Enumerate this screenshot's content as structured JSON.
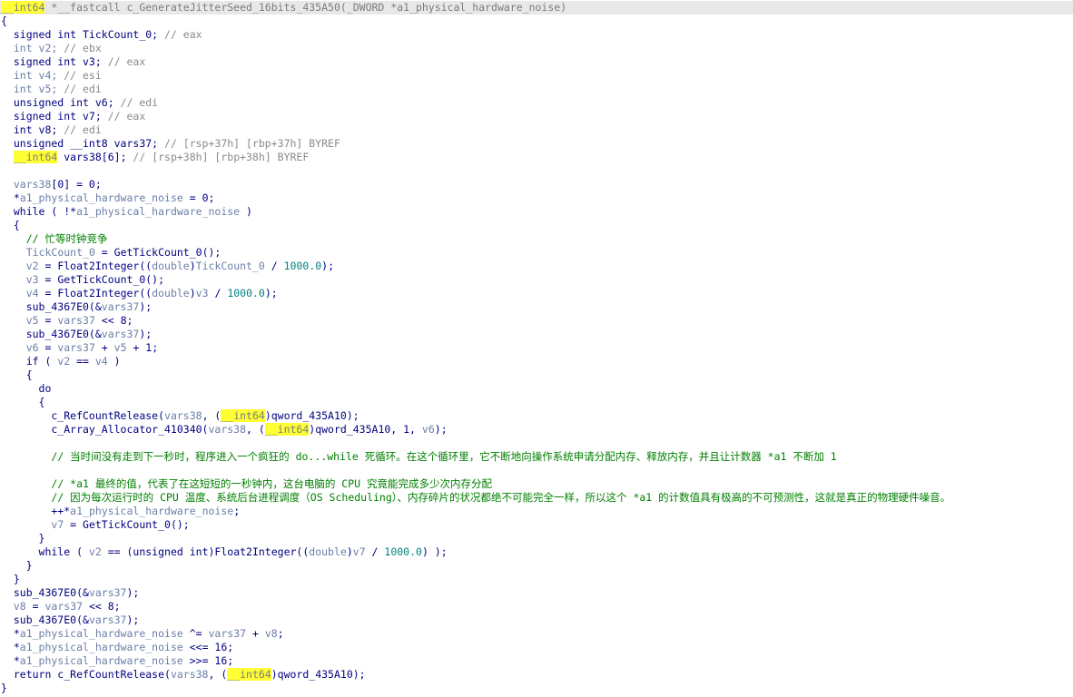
{
  "lines": [
    [
      [
        "hl",
        "__int64"
      ],
      [
        "dim",
        " *__fastcall c_GenerateJitterSeed_16bits_435A50(_DWORD *a1_physical_hardware_noise)"
      ]
    ],
    [
      [
        "code",
        "{"
      ]
    ],
    [
      [
        "code",
        "  signed int TickCount_0; "
      ],
      [
        "comment",
        "// eax"
      ]
    ],
    [
      [
        "var",
        "  int v2; "
      ],
      [
        "comment",
        "// ebx"
      ]
    ],
    [
      [
        "code",
        "  signed int v3; "
      ],
      [
        "comment",
        "// eax"
      ]
    ],
    [
      [
        "var",
        "  int v4; "
      ],
      [
        "comment",
        "// esi"
      ]
    ],
    [
      [
        "var",
        "  int v5; "
      ],
      [
        "comment",
        "// edi"
      ]
    ],
    [
      [
        "code",
        "  unsigned int v6; "
      ],
      [
        "comment",
        "// edi"
      ]
    ],
    [
      [
        "code",
        "  signed int v7; "
      ],
      [
        "comment",
        "// eax"
      ]
    ],
    [
      [
        "code",
        "  int v8; "
      ],
      [
        "comment",
        "// edi"
      ]
    ],
    [
      [
        "code",
        "  unsigned __int8 vars37; "
      ],
      [
        "comment",
        "// [rsp+37h] [rbp+37h] BYREF"
      ]
    ],
    [
      [
        "code",
        "  "
      ],
      [
        "hl",
        "__int64"
      ],
      [
        "code",
        " vars38[6]; "
      ],
      [
        "comment",
        "// [rsp+38h] [rbp+38h] BYREF"
      ]
    ],
    [
      [
        "code",
        ""
      ]
    ],
    [
      [
        "var",
        "  vars38"
      ],
      [
        "code",
        "[0] = 0;"
      ]
    ],
    [
      [
        "code",
        "  *"
      ],
      [
        "var",
        "a1_physical_hardware_noise"
      ],
      [
        "code",
        " = 0;"
      ]
    ],
    [
      [
        "code",
        "  while ( !*"
      ],
      [
        "var",
        "a1_physical_hardware_noise"
      ],
      [
        "code",
        " )"
      ]
    ],
    [
      [
        "code",
        "  {"
      ]
    ],
    [
      [
        "code",
        "    "
      ],
      [
        "commentg",
        "// 忙等时钟竞争"
      ]
    ],
    [
      [
        "code",
        "    "
      ],
      [
        "var",
        "TickCount_0"
      ],
      [
        "code",
        " = GetTickCount_0();"
      ]
    ],
    [
      [
        "code",
        "    "
      ],
      [
        "var",
        "v2"
      ],
      [
        "code",
        " = Float2Integer(("
      ],
      [
        "var",
        "double"
      ],
      [
        "code",
        ")"
      ],
      [
        "var",
        "TickCount_0"
      ],
      [
        "code",
        " / "
      ],
      [
        "num",
        "1000.0"
      ],
      [
        "code",
        ");"
      ]
    ],
    [
      [
        "code",
        "    "
      ],
      [
        "var",
        "v3"
      ],
      [
        "code",
        " = GetTickCount_0();"
      ]
    ],
    [
      [
        "code",
        "    "
      ],
      [
        "var",
        "v4"
      ],
      [
        "code",
        " = Float2Integer(("
      ],
      [
        "var",
        "double"
      ],
      [
        "code",
        ")"
      ],
      [
        "var",
        "v3"
      ],
      [
        "code",
        " / "
      ],
      [
        "num",
        "1000.0"
      ],
      [
        "code",
        ");"
      ]
    ],
    [
      [
        "code",
        "    sub_4367E0(&"
      ],
      [
        "var",
        "vars37"
      ],
      [
        "code",
        ");"
      ]
    ],
    [
      [
        "code",
        "    "
      ],
      [
        "var",
        "v5"
      ],
      [
        "code",
        " = "
      ],
      [
        "var",
        "vars37"
      ],
      [
        "code",
        " << 8;"
      ]
    ],
    [
      [
        "code",
        "    sub_4367E0(&"
      ],
      [
        "var",
        "vars37"
      ],
      [
        "code",
        ");"
      ]
    ],
    [
      [
        "code",
        "    "
      ],
      [
        "var",
        "v6"
      ],
      [
        "code",
        " = "
      ],
      [
        "var",
        "vars37"
      ],
      [
        "code",
        " + "
      ],
      [
        "var",
        "v5"
      ],
      [
        "code",
        " + 1;"
      ]
    ],
    [
      [
        "code",
        "    if ( "
      ],
      [
        "var",
        "v2"
      ],
      [
        "code",
        " == "
      ],
      [
        "var",
        "v4"
      ],
      [
        "code",
        " )"
      ]
    ],
    [
      [
        "code",
        "    {"
      ]
    ],
    [
      [
        "code",
        "      do"
      ]
    ],
    [
      [
        "code",
        "      {"
      ]
    ],
    [
      [
        "code",
        "        c_RefCountRelease("
      ],
      [
        "var",
        "vars38"
      ],
      [
        "code",
        ", ("
      ],
      [
        "hl",
        "__int64"
      ],
      [
        "code",
        ")qword_435A10);"
      ]
    ],
    [
      [
        "code",
        "        c_Array_Allocator_410340("
      ],
      [
        "var",
        "vars38"
      ],
      [
        "code",
        ", ("
      ],
      [
        "hl",
        "__int64"
      ],
      [
        "code",
        ")qword_435A10, 1, "
      ],
      [
        "var",
        "v6"
      ],
      [
        "code",
        ");"
      ]
    ],
    [
      [
        "code",
        ""
      ]
    ],
    [
      [
        "code",
        "        "
      ],
      [
        "commentg",
        "// 当时间没有走到下一秒时，程序进入一个疯狂的 do...while 死循环。在这个循环里，它不断地向操作系统申请分配内存、释放内存，并且让计数器 *a1 不断加 1"
      ]
    ],
    [
      [
        "code",
        ""
      ]
    ],
    [
      [
        "code",
        "        "
      ],
      [
        "commentg",
        "// *a1 最终的值，代表了在这短短的一秒钟内，这台电脑的 CPU 究竟能完成多少次内存分配"
      ]
    ],
    [
      [
        "code",
        "        "
      ],
      [
        "commentg",
        "// 因为每次运行时的 CPU 温度、系统后台进程调度（OS Scheduling）、内存碎片的状况都绝不可能完全一样，所以这个 *a1 的计数值具有极高的不可预测性，这就是真正的物理硬件噪音。"
      ]
    ],
    [
      [
        "code",
        "        ++*"
      ],
      [
        "var",
        "a1_physical_hardware_noise"
      ],
      [
        "code",
        ";"
      ]
    ],
    [
      [
        "code",
        "        "
      ],
      [
        "var",
        "v7"
      ],
      [
        "code",
        " = GetTickCount_0();"
      ]
    ],
    [
      [
        "code",
        "      }"
      ]
    ],
    [
      [
        "code",
        "      while ( "
      ],
      [
        "var",
        "v2"
      ],
      [
        "code",
        " == (unsigned int)Float2Integer(("
      ],
      [
        "var",
        "double"
      ],
      [
        "code",
        ")"
      ],
      [
        "var",
        "v7"
      ],
      [
        "code",
        " / "
      ],
      [
        "num",
        "1000.0"
      ],
      [
        "code",
        ") );"
      ]
    ],
    [
      [
        "code",
        "    }"
      ]
    ],
    [
      [
        "code",
        "  }"
      ]
    ],
    [
      [
        "code",
        "  sub_4367E0(&"
      ],
      [
        "var",
        "vars37"
      ],
      [
        "code",
        ");"
      ]
    ],
    [
      [
        "code",
        "  "
      ],
      [
        "var",
        "v8"
      ],
      [
        "code",
        " = "
      ],
      [
        "var",
        "vars37"
      ],
      [
        "code",
        " << 8;"
      ]
    ],
    [
      [
        "code",
        "  sub_4367E0(&"
      ],
      [
        "var",
        "vars37"
      ],
      [
        "code",
        ");"
      ]
    ],
    [
      [
        "code",
        "  *"
      ],
      [
        "var",
        "a1_physical_hardware_noise"
      ],
      [
        "code",
        " ^= "
      ],
      [
        "var",
        "vars37"
      ],
      [
        "code",
        " + "
      ],
      [
        "var",
        "v8"
      ],
      [
        "code",
        ";"
      ]
    ],
    [
      [
        "code",
        "  *"
      ],
      [
        "var",
        "a1_physical_hardware_noise"
      ],
      [
        "code",
        " <<= 16;"
      ]
    ],
    [
      [
        "code",
        "  *"
      ],
      [
        "var",
        "a1_physical_hardware_noise"
      ],
      [
        "code",
        " >>= 16;"
      ]
    ],
    [
      [
        "code",
        "  return c_RefCountRelease("
      ],
      [
        "var",
        "vars38"
      ],
      [
        "code",
        ", ("
      ],
      [
        "hl",
        "__int64"
      ],
      [
        "code",
        ")qword_435A10);"
      ]
    ],
    [
      [
        "code",
        "}"
      ]
    ]
  ]
}
